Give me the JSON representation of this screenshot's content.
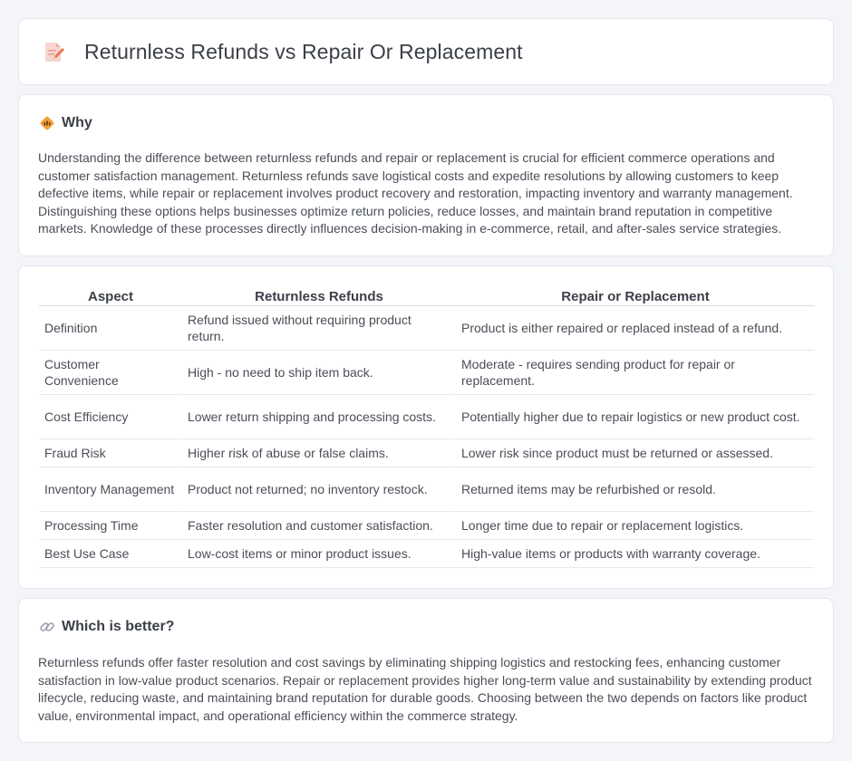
{
  "header": {
    "title": "Returnless Refunds vs Repair Or Replacement",
    "icon": "document-pencil-icon"
  },
  "why": {
    "title": "Why",
    "icon": "diamond-warning-icon",
    "text": "Understanding the difference between returnless refunds and repair or replacement is crucial for efficient commerce operations and customer satisfaction management. Returnless refunds save logistical costs and expedite resolutions by allowing customers to keep defective items, while repair or replacement involves product recovery and restoration, impacting inventory and warranty management. Distinguishing these options helps businesses optimize return policies, reduce losses, and maintain brand reputation in competitive markets. Knowledge of these processes directly influences decision-making in e-commerce, retail, and after-sales service strategies."
  },
  "table": {
    "headers": [
      "Aspect",
      "Returnless Refunds",
      "Repair or Replacement"
    ],
    "rows": [
      [
        "Definition",
        "Refund issued without requiring product return.",
        "Product is either repaired or replaced instead of a refund."
      ],
      [
        "Customer Convenience",
        "High - no need to ship item back.",
        "Moderate - requires sending product for repair or replacement."
      ],
      [
        "Cost Efficiency",
        "Lower return shipping and processing costs.",
        "Potentially higher due to repair logistics or new product cost."
      ],
      [
        "Fraud Risk",
        "Higher risk of abuse or false claims.",
        "Lower risk since product must be returned or assessed."
      ],
      [
        "Inventory Management",
        "Product not returned; no inventory restock.",
        "Returned items may be refurbished or resold."
      ],
      [
        "Processing Time",
        "Faster resolution and customer satisfaction.",
        "Longer time due to repair or replacement logistics."
      ],
      [
        "Best Use Case",
        "Low-cost items or minor product issues.",
        "High-value items or products with warranty coverage."
      ]
    ]
  },
  "better": {
    "title": "Which is better?",
    "icon": "link-icon",
    "text": "Returnless refunds offer faster resolution and cost savings by eliminating shipping logistics and restocking fees, enhancing customer satisfaction in low-value product scenarios. Repair or replacement provides higher long-term value and sustainability by extending product lifecycle, reducing waste, and maintaining brand reputation for durable goods. Choosing between the two depends on factors like product value, environmental impact, and operational efficiency within the commerce strategy."
  },
  "colors": {
    "background": "#f4f5f9",
    "card": "#ffffff",
    "border": "#e3e6ee",
    "icon_accent": "#e8734d",
    "warning_accent": "#f2a035"
  }
}
